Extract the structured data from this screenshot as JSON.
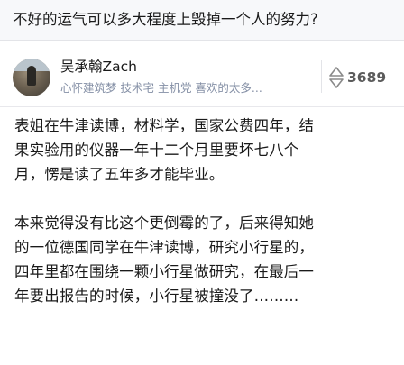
{
  "question": {
    "title": "不好的运气可以多大程度上毁掉一个人的努力?"
  },
  "author": {
    "name": "吴承翰Zach",
    "bio": "心怀建筑梦 技术宅 主机党 喜欢的太多...",
    "avatar_icon": "avatar-photo"
  },
  "votes": {
    "icon": "vote-up-down-icon",
    "count": "3689"
  },
  "answer": {
    "paragraphs": [
      {
        "lines": [
          "表姐在牛津读博，材料学，国家公费四年，结",
          "果实验用的仪器一年十二个月里要坏七八个",
          "月，愣是读了五年多才能毕业。"
        ]
      },
      {
        "lines": [
          "本来觉得没有比这个更倒霉的了，后来得知她",
          "的一位德国同学在牛津读博，研究小行星的，",
          "四年里都在围绕一颗小行星做研究，在最后一",
          "年要出报告的时候，小行星被撞没了………"
        ]
      }
    ]
  },
  "colors": {
    "header_bg": "#f7f8fa",
    "muted_text": "#8590a6",
    "vote_text": "#5b5b5b"
  }
}
